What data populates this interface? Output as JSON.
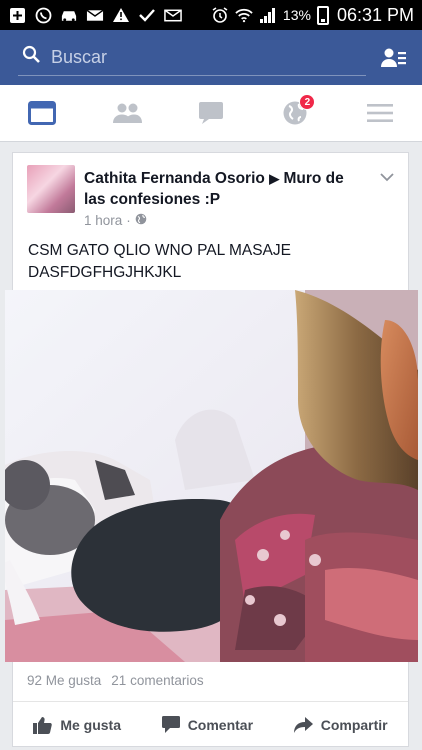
{
  "status_bar": {
    "battery": "13%",
    "time": "06:31 PM"
  },
  "search": {
    "placeholder": "Buscar"
  },
  "nav": {
    "notifications_badge": "2"
  },
  "post": {
    "author": "Cathita Fernanda Osorio",
    "target": "Muro de las confesiones :P",
    "time": "1 hora",
    "text_line1": "CSM GATO QLIO WNO PAL MASAJE",
    "text_line2": "DASFDGFHGJHKJKL",
    "likes": "92 Me gusta",
    "comments": "21 comentarios"
  },
  "actions": {
    "like": "Me gusta",
    "comment": "Comentar",
    "share": "Compartir"
  },
  "colors": {
    "brand_blue": "#3b5998",
    "nav_active": "#4267b2",
    "badge_red": "#f02849"
  }
}
